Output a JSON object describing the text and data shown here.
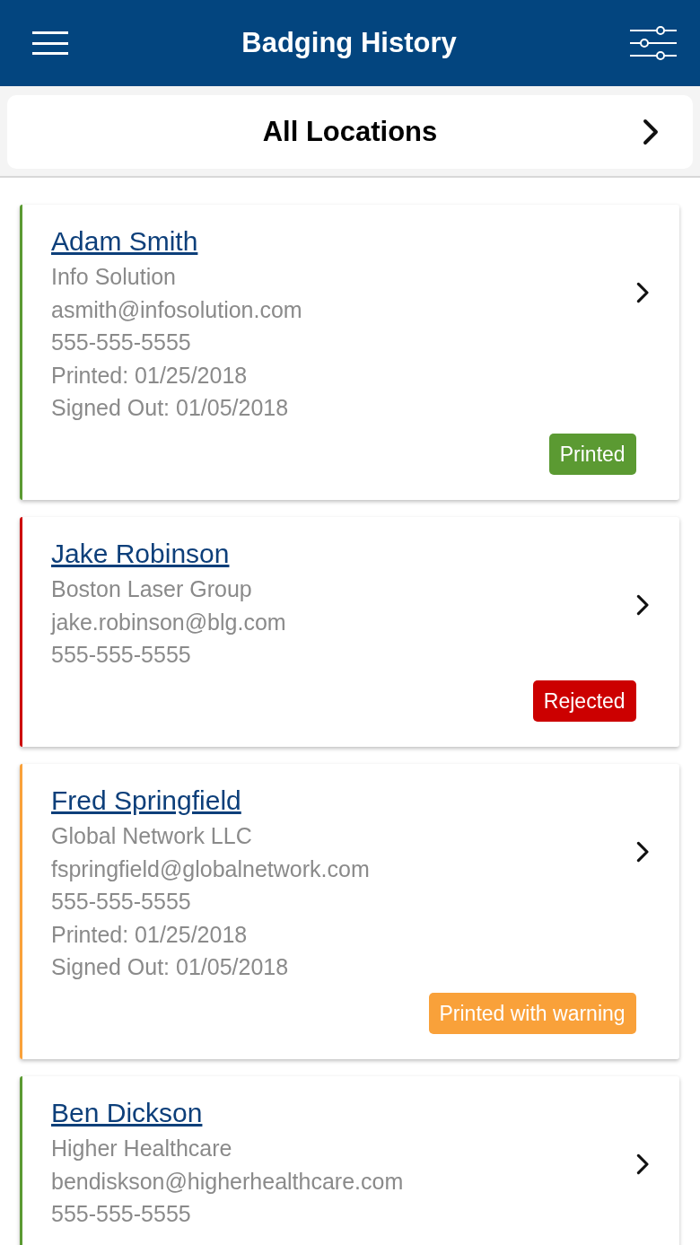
{
  "header": {
    "title": "Badging History"
  },
  "location_bar": {
    "label": "All Locations"
  },
  "visitors": [
    {
      "name": "Adam Smith",
      "color": "#5b9a32",
      "lines": [
        "Info Solution",
        "asmith@infosolution.com",
        "555-555-5555",
        "Printed: 01/25/2018",
        "Signed Out: 01/05/2018"
      ],
      "status": "Printed"
    },
    {
      "name": "Jake Robinson",
      "color": "#cc0000",
      "lines": [
        "Boston Laser Group",
        "jake.robinson@blg.com",
        "555-555-5555"
      ],
      "status": "Rejected"
    },
    {
      "name": "Fred Springfield",
      "color": "#f9a13a",
      "lines": [
        "Global Network LLC",
        "fspringfield@globalnetwork.com",
        "555-555-5555",
        "Printed: 01/25/2018",
        "Signed Out: 01/05/2018"
      ],
      "status": "Printed with warning"
    },
    {
      "name": "Ben Dickson",
      "color": "#5b9a32",
      "lines": [
        "Higher Healthcare",
        "bendiskson@higherhealthcare.com",
        "555-555-5555"
      ]
    }
  ]
}
